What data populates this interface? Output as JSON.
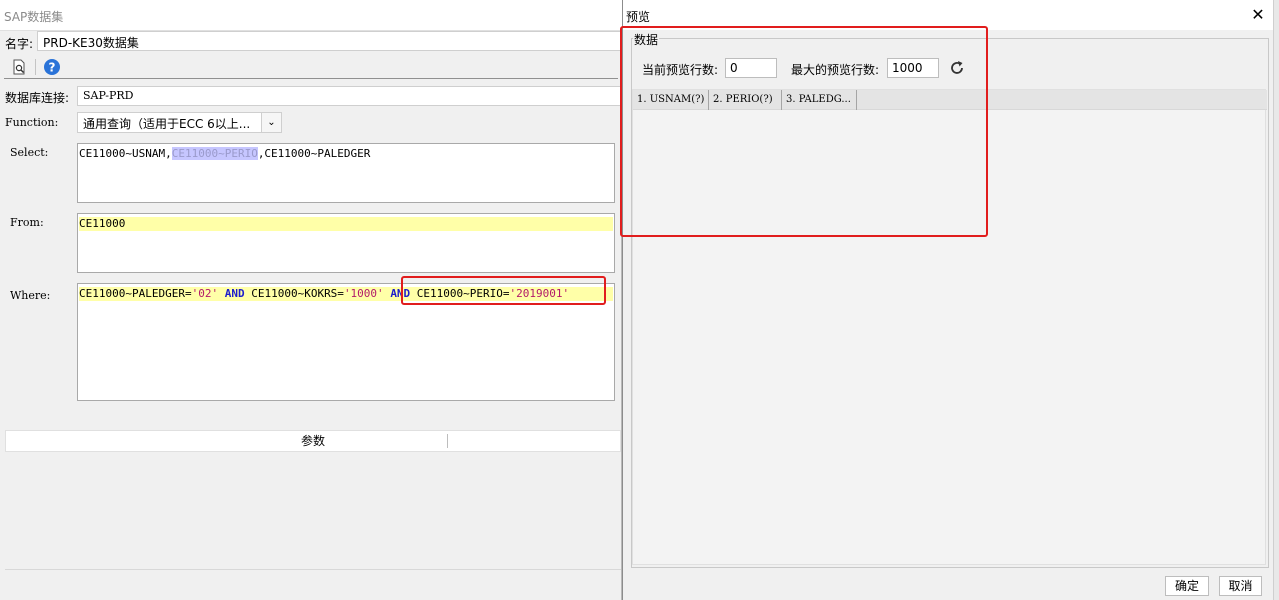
{
  "left_window": {
    "title": "SAP数据集",
    "name_label": "名字:",
    "name_value": "PRD-KE30数据集",
    "db_label": "数据库连接:",
    "db_value": "SAP-PRD",
    "function_label": "Function:",
    "function_value": "通用查询（适用于ECC 6以上...",
    "select_label": "Select:",
    "select_part1": "CE11000~USNAM,",
    "select_selected": "CE11000~PERIO",
    "select_part2": ",CE11000~PALEDGER",
    "from_label": "From:",
    "from_value": "CE11000",
    "where_label": "Where:",
    "where": {
      "p1": "CE11000~PALEDGER=",
      "s1": "'02'",
      "kw1": "AND",
      "p2": " CE11000~KOKRS=",
      "s2": "'1000'",
      "kw2": "AND",
      "p3": " CE11000~PERIO=",
      "s3": "'2019001'"
    },
    "params_header": "参数",
    "toolbar": {
      "preview_icon": "preview-document-icon",
      "help_icon": "help-icon"
    }
  },
  "preview_window": {
    "title": "预览",
    "group_label": "数据",
    "current_rows_label": "当前预览行数:",
    "current_rows_value": "0",
    "max_rows_label": "最大的预览行数:",
    "max_rows_value": "1000",
    "columns": [
      "1. USNAM(?)",
      "2. PERIO(?)",
      "3. PALEDG..."
    ],
    "ok_label": "确定",
    "cancel_label": "取消"
  },
  "colors": {
    "highlight_yellow": "#ffffa8",
    "keyword_blue": "#1c1ccc",
    "string_magenta": "#b21a6a",
    "annotation_red": "#e11d1d"
  }
}
